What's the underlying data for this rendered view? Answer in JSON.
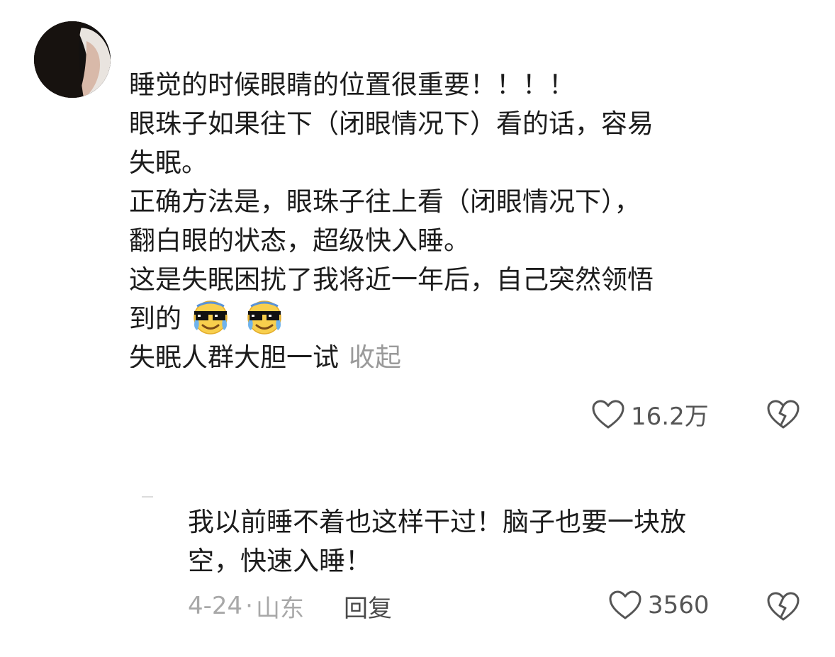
{
  "comment": {
    "lines": [
      "睡觉的时候眼睛的位置很重要！！！！",
      "眼珠子如果往下（闭眼情况下）看的话，容易",
      "失眠。",
      "正确方法是，眼珠子往上看（闭眼情况下），",
      "翻白眼的状态，超级快入睡。",
      "这是失眠困扰了我将近一年后，自己突然领悟"
    ],
    "last_line_text": "到的",
    "emojis": [
      "crying-sunglasses-emoji",
      "crying-sunglasses-emoji"
    ],
    "truncated_line": "失眠人群大胆一试",
    "collapse_label": "收起",
    "like_count": "16.2万"
  },
  "reply": {
    "lines": [
      "我以前睡不着也这样干过！脑子也要一块放",
      "空，快速入睡！"
    ],
    "date": "4-24",
    "separator": "·",
    "location": "山东",
    "reply_label": "回复",
    "like_count": "3560"
  },
  "icons": {
    "like": "heart-outline-icon",
    "dislike": "broken-heart-icon"
  },
  "colors": {
    "text": "#1c1c1c",
    "muted": "#9a9a9a",
    "icon": "#555555"
  }
}
